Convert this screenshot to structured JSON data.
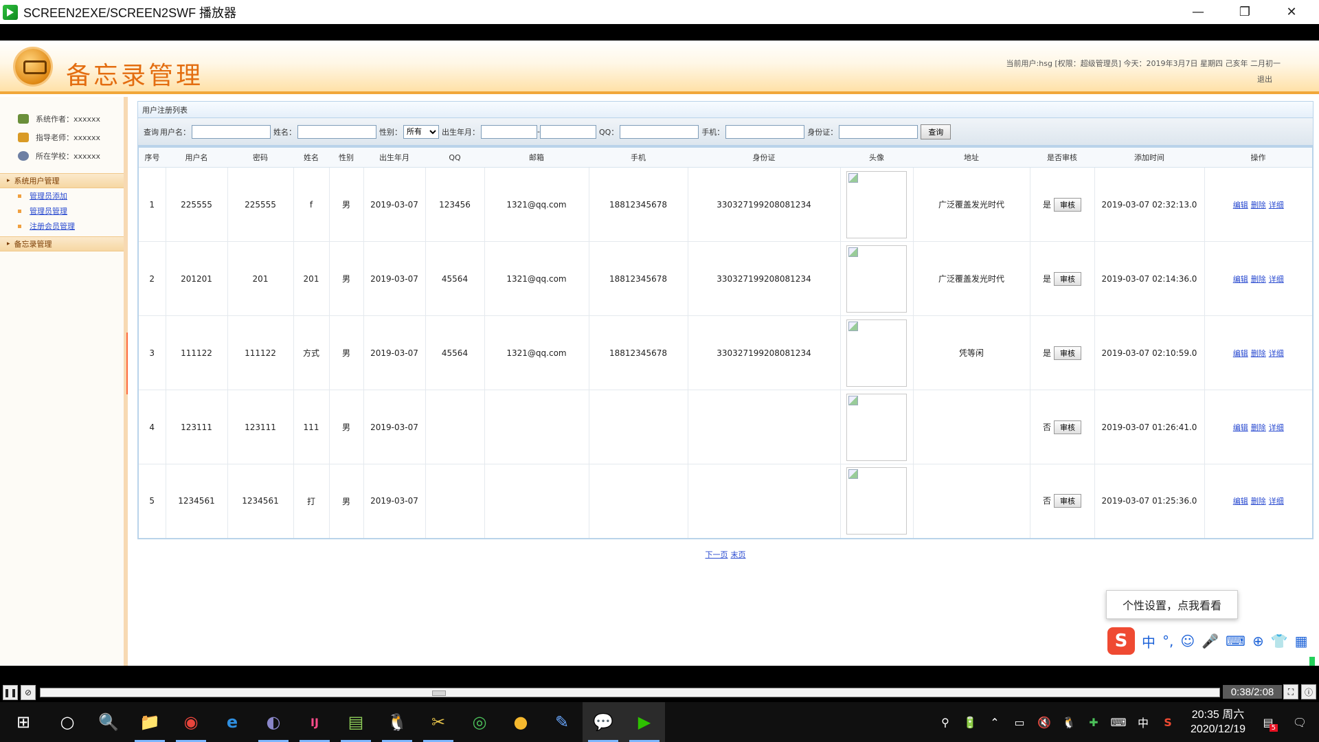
{
  "window": {
    "title": "SCREEN2EXE/SCREEN2SWF 播放器",
    "minimize": "—",
    "restore": "❐",
    "close": "✕"
  },
  "header": {
    "app_title": "备忘录管理",
    "user_info": "当前用户:hsg [权限：超级管理员] 今天：2019年3月7日 星期四 己亥年 二月初一",
    "logout": "退出"
  },
  "sidebar": {
    "info": [
      {
        "label": "系统作者：xxxxxx",
        "color": "#6a8f3a"
      },
      {
        "label": "指导老师：xxxxxx",
        "color": "#d99a25"
      },
      {
        "label": "所在学校：xxxxxx",
        "color": "#6d7fa3"
      }
    ],
    "groups": [
      {
        "title": "系统用户管理",
        "items": [
          "管理员添加",
          "管理员管理",
          "注册会员管理"
        ]
      },
      {
        "title": "备忘录管理",
        "items": []
      }
    ]
  },
  "panel": {
    "caption": "用户注册列表"
  },
  "search": {
    "prefix": "查询",
    "username_label": "用户名：",
    "name_label": "姓名：",
    "gender_label": "性别：",
    "gender_value": "所有",
    "birth_label": "出生年月：",
    "birth_sep": "-",
    "qq_label": "QQ：",
    "phone_label": "手机：",
    "idcard_label": "身份证：",
    "query_button": "查询"
  },
  "table": {
    "headers": [
      "序号",
      "用户名",
      "密码",
      "姓名",
      "性别",
      "出生年月",
      "QQ",
      "邮箱",
      "手机",
      "身份证",
      "头像",
      "地址",
      "是否审核",
      "添加时间",
      "操作"
    ],
    "audit_button": "审核",
    "ops": [
      "编辑",
      "删除",
      "详细"
    ],
    "rows": [
      {
        "no": "1",
        "user": "225555",
        "pwd": "225555",
        "name": "f",
        "gender": "男",
        "birth": "2019-03-07",
        "qq": "123456",
        "email": "1321@qq.com",
        "phone": "18812345678",
        "idcard": "330327199208081234",
        "addr": "广泛覆盖发光时代",
        "audited": "是",
        "time": "2019-03-07 02:32:13.0"
      },
      {
        "no": "2",
        "user": "201201",
        "pwd": "201",
        "name": "201",
        "gender": "男",
        "birth": "2019-03-07",
        "qq": "45564",
        "email": "1321@qq.com",
        "phone": "18812345678",
        "idcard": "330327199208081234",
        "addr": "广泛覆盖发光时代",
        "audited": "是",
        "time": "2019-03-07 02:14:36.0"
      },
      {
        "no": "3",
        "user": "111122",
        "pwd": "111122",
        "name": "方式",
        "gender": "男",
        "birth": "2019-03-07",
        "qq": "45564",
        "email": "1321@qq.com",
        "phone": "18812345678",
        "idcard": "330327199208081234",
        "addr": "凭等闲",
        "audited": "是",
        "time": "2019-03-07 02:10:59.0"
      },
      {
        "no": "4",
        "user": "123111",
        "pwd": "123111",
        "name": "111",
        "gender": "男",
        "birth": "2019-03-07",
        "qq": "",
        "email": "",
        "phone": "",
        "idcard": "",
        "addr": "",
        "audited": "否",
        "time": "2019-03-07 01:26:41.0"
      },
      {
        "no": "5",
        "user": "1234561",
        "pwd": "1234561",
        "name": "打",
        "gender": "男",
        "birth": "2019-03-07",
        "qq": "",
        "email": "",
        "phone": "",
        "idcard": "",
        "addr": "",
        "audited": "否",
        "time": "2019-03-07 01:25:36.0"
      }
    ]
  },
  "pager": {
    "next": "下一页",
    "last": "末页"
  },
  "ime": {
    "tip": "个性设置，点我看看",
    "logo": "S",
    "mode": "中",
    "punct": "°,",
    "emoji": "☺",
    "mic": "🎤",
    "keyboard": "⌨",
    "toolbox": "⊕",
    "skin": "👕",
    "more": "▦"
  },
  "player": {
    "time": "0:38/2:08",
    "pause_icon": "❚❚",
    "stop_icon": "⊘",
    "fit_icon": "⛶",
    "info_icon": "ⓘ"
  },
  "taskbar": {
    "start_icon": "⊞",
    "cortana_icon": "○",
    "search_icon": "🔍",
    "explorer_icon": "📁",
    "chrome_icon": "◉",
    "edge_icon": "e",
    "eclipse_icon": "◐",
    "idea_icon": "IJ",
    "notepad_icon": "▤",
    "qq_icon": "🐧",
    "tools_icon": "✂",
    "browser360_icon": "◎",
    "app_icon": "●",
    "pen_icon": "✎",
    "wechat_icon": "💬",
    "player_icon": "▶",
    "tray": [
      "⚲",
      "🔋",
      "⌃",
      "▭",
      "🔇",
      "🐧",
      "✚",
      "⌨",
      "中",
      "S"
    ],
    "clock_time": "20:35 周六",
    "clock_date": "2020/12/19",
    "notif_icon": "▤",
    "notif_count": "5",
    "action_center_icon": "🗨"
  }
}
